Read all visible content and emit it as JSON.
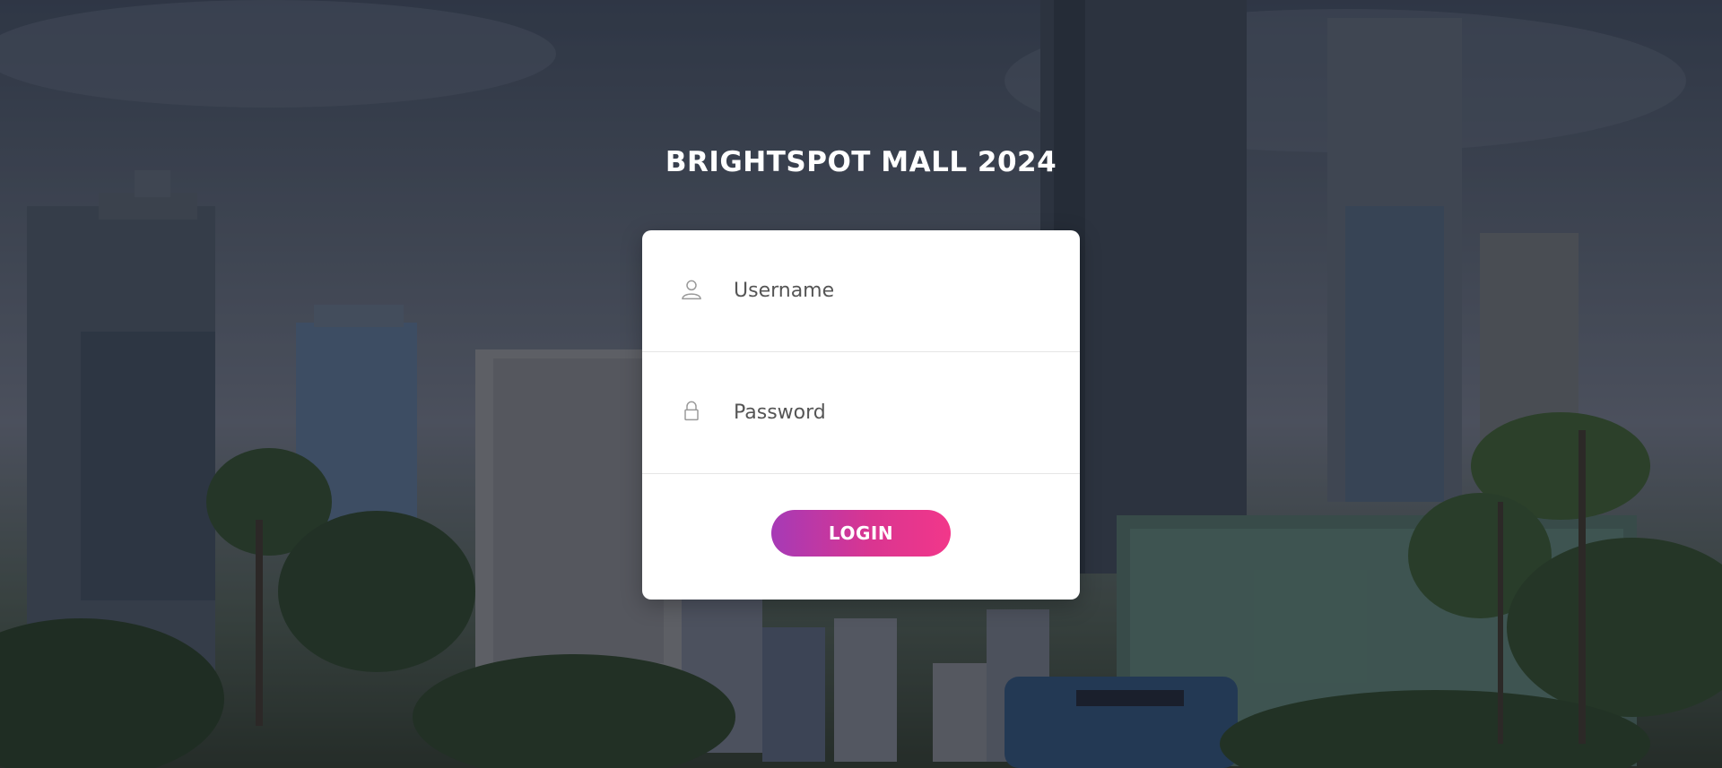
{
  "page": {
    "title": "BRIGHTSPOT MALL 2024"
  },
  "login_form": {
    "username": {
      "placeholder": "Username",
      "value": "",
      "icon": "user-icon"
    },
    "password": {
      "placeholder": "Password",
      "value": "",
      "icon": "lock-icon"
    },
    "submit_label": "LOGIN"
  },
  "colors": {
    "button_gradient_start": "#a63ab6",
    "button_gradient_end": "#f2378a",
    "card_background": "#ffffff",
    "title_color": "#ffffff"
  }
}
